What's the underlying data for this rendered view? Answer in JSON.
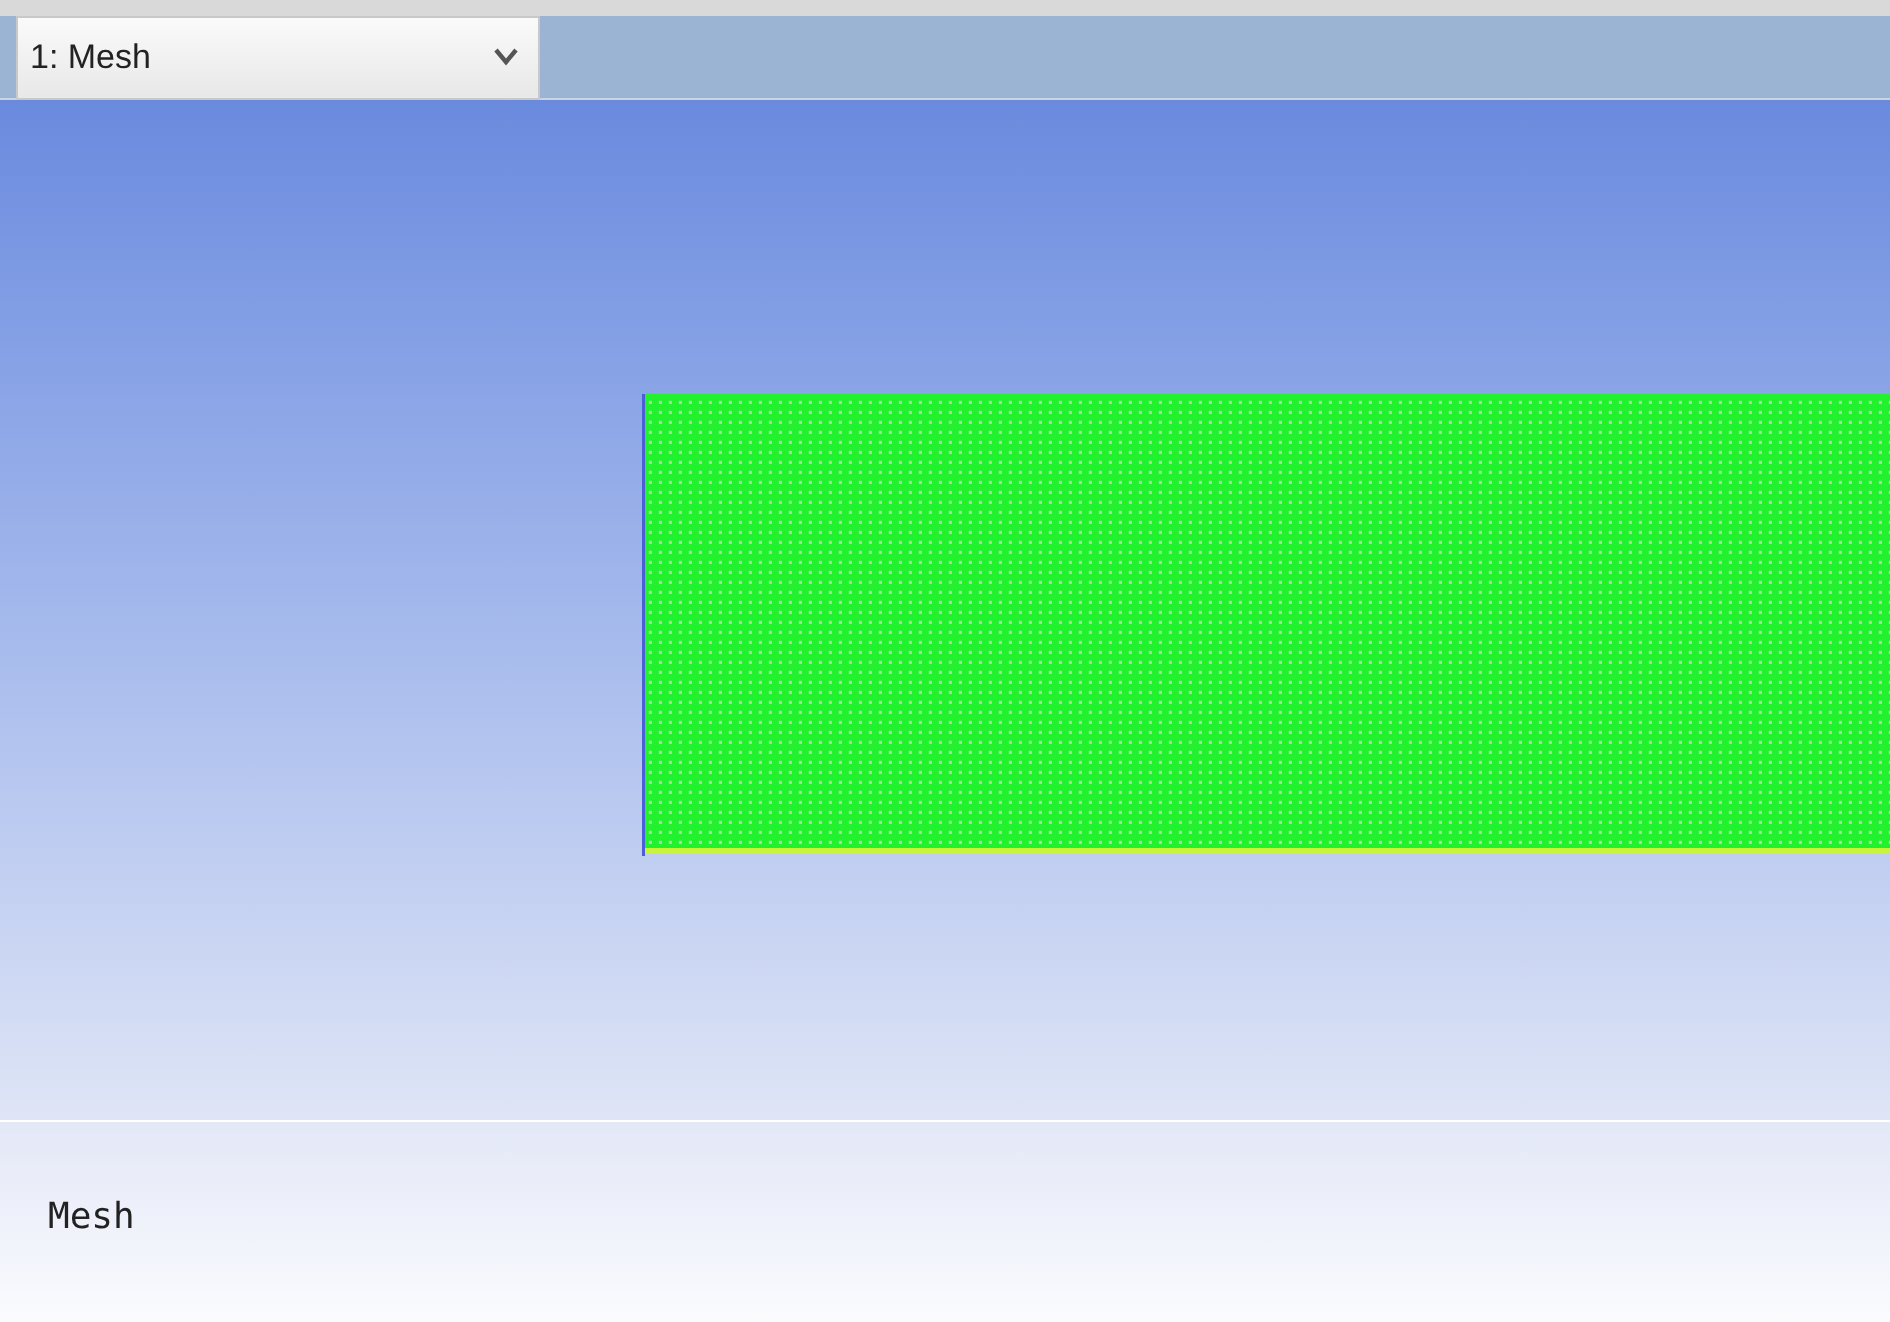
{
  "view_selector": {
    "value": "1: Mesh"
  },
  "viewport_label": "Mesh"
}
